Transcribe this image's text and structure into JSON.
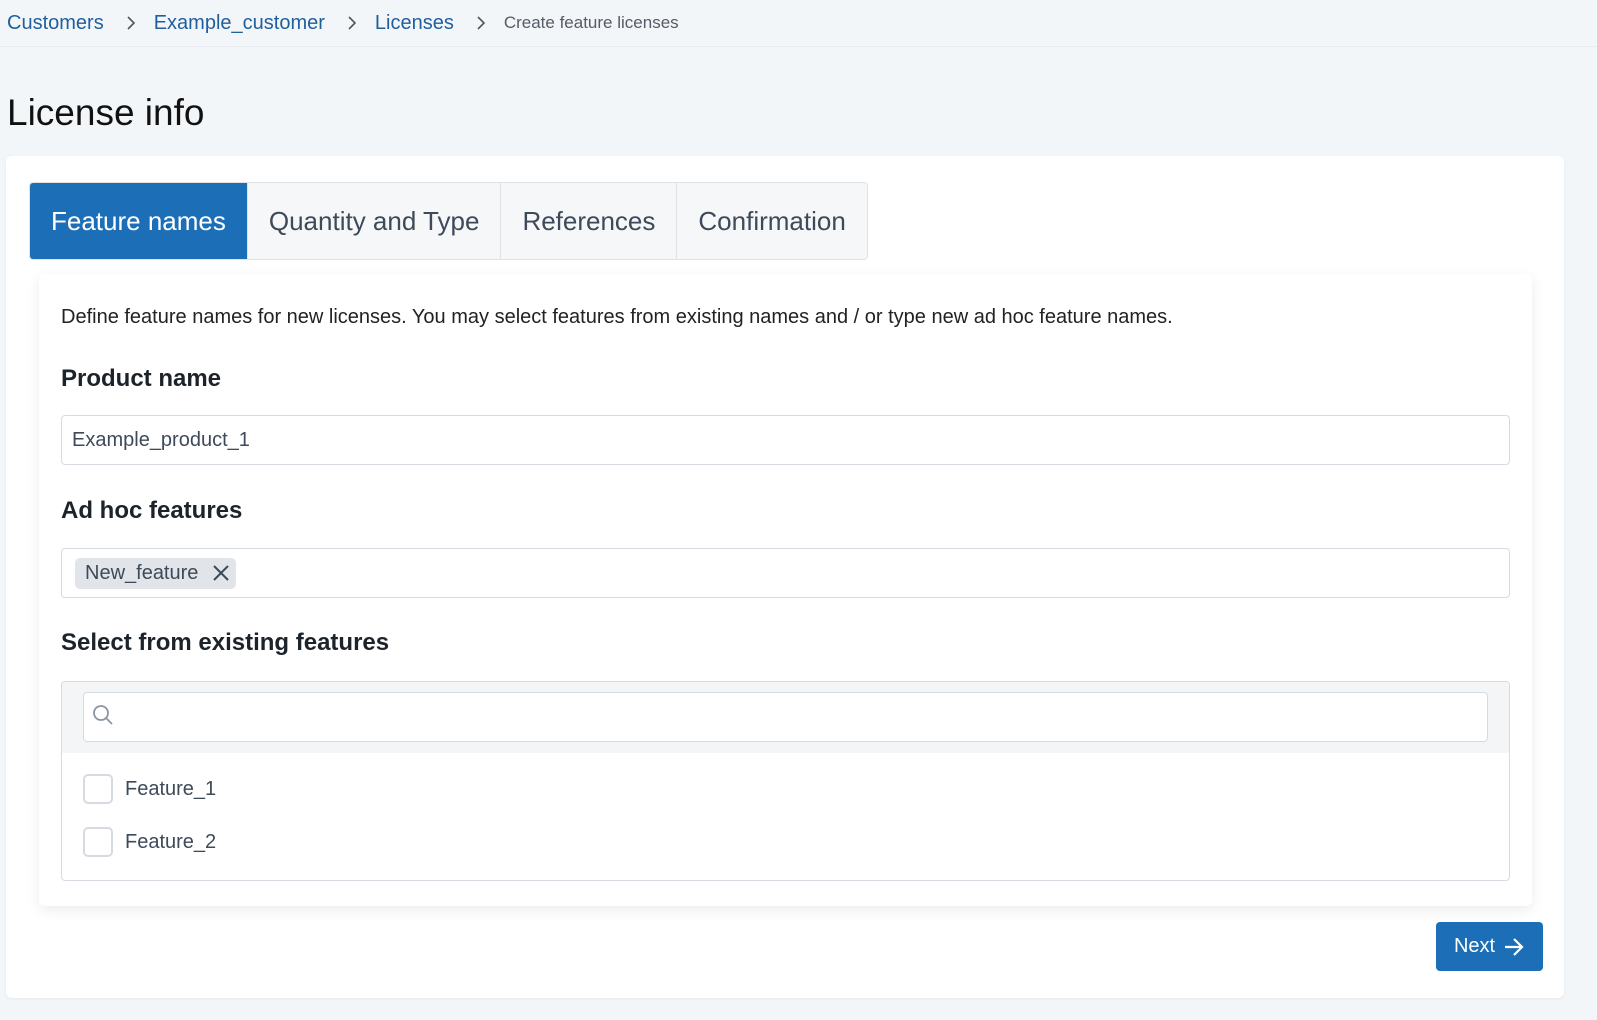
{
  "breadcrumb": {
    "items": [
      {
        "label": "Customers"
      },
      {
        "label": "Example_customer"
      },
      {
        "label": "Licenses"
      }
    ],
    "current": "Create feature licenses",
    "separator_icon": "chevron-right-icon"
  },
  "page": {
    "title": "License info"
  },
  "tabs": [
    {
      "label": "Feature names",
      "active": true
    },
    {
      "label": "Quantity and Type",
      "active": false
    },
    {
      "label": "References",
      "active": false
    },
    {
      "label": "Confirmation",
      "active": false
    }
  ],
  "form": {
    "description": "Define feature names for new licenses. You may select features from existing names and / or type new ad hoc feature names.",
    "product_name": {
      "label": "Product name",
      "value": "Example_product_1"
    },
    "ad_hoc_features": {
      "label": "Ad hoc features",
      "chips": [
        {
          "label": "New_feature",
          "remove_icon": "close-icon"
        }
      ]
    },
    "existing_features": {
      "label": "Select from existing features",
      "search_placeholder": "",
      "search_icon": "search-icon",
      "options": [
        {
          "label": "Feature_1",
          "checked": false
        },
        {
          "label": "Feature_2",
          "checked": false
        }
      ]
    }
  },
  "actions": {
    "next_label": "Next",
    "next_icon": "arrow-right-icon"
  },
  "colors": {
    "primary": "#1c6fb7",
    "link": "#1f5f9e",
    "background": "#f3f6f9"
  }
}
